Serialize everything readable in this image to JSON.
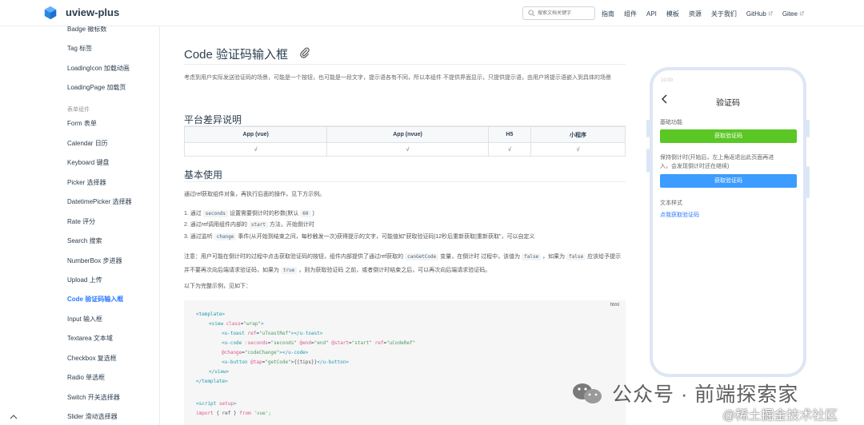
{
  "navbar": {
    "site_name": "uview-plus",
    "search_placeholder": "搜索文档关键字",
    "links": [
      "指南",
      "组件",
      "API",
      "模板",
      "资源",
      "关于我们",
      "GitHub",
      "Gitee"
    ],
    "brand_color": "#2979ff"
  },
  "sidebar": {
    "items": [
      {
        "label": "Badge 徽标数",
        "type": "item"
      },
      {
        "label": "Tag 标签",
        "type": "item"
      },
      {
        "label": "LoadingIcon 加载动画",
        "type": "item"
      },
      {
        "label": "LoadingPage 加载页",
        "type": "item"
      },
      {
        "label": "表单组件",
        "type": "group"
      },
      {
        "label": "Form 表单",
        "type": "item"
      },
      {
        "label": "Calendar 日历",
        "type": "item"
      },
      {
        "label": "Keyboard 键盘",
        "type": "item"
      },
      {
        "label": "Picker 选择器",
        "type": "item"
      },
      {
        "label": "DatetimePicker 选择器",
        "type": "item"
      },
      {
        "label": "Rate 评分",
        "type": "item"
      },
      {
        "label": "Search 搜索",
        "type": "item"
      },
      {
        "label": "NumberBox 步进器",
        "type": "item"
      },
      {
        "label": "Upload 上传",
        "type": "item"
      },
      {
        "label": "Code 验证码输入框",
        "type": "active"
      },
      {
        "label": "Input 输入框",
        "type": "item"
      },
      {
        "label": "Textarea 文本域",
        "type": "item"
      },
      {
        "label": "Checkbox 复选框",
        "type": "item"
      },
      {
        "label": "Radio 单选框",
        "type": "item"
      },
      {
        "label": "Switch 开关选择器",
        "type": "item"
      },
      {
        "label": "Slider 滑动选择器",
        "type": "item"
      }
    ]
  },
  "main": {
    "title": "Code 验证码输入框",
    "intro": "考虑到用户实际发送验证码的场景，可能是一个按钮，也可能是一段文字，提示语各有不同，所以本组件 不提供界面显示，只提供提示语，由用户将提示语嵌入到具体的场景",
    "section1_title": "平台差异说明",
    "table": {
      "headers": [
        "App (vue)",
        "App (nvue)",
        "H5",
        "小程序"
      ],
      "row": [
        "√",
        "√",
        "√",
        "√"
      ]
    },
    "section2_title": "基本使用",
    "usage_intro": "通过ref获取组件对象，再执行后面的操作，见下方示例。",
    "steps": {
      "s1_a": "1. 通过",
      "s1_code": "seconds",
      "s1_b": "设置需要倒计时的秒数(默认",
      "s1_code2": "60",
      "s1_c": ")",
      "s2_a": "2. 通过ref调用组件内部的",
      "s2_code": "start",
      "s2_b": "方法，开始倒计时",
      "s3_a": "3. 通过监听",
      "s3_code": "change",
      "s3_b": "事件(从开始到结束之间，每秒触发一次)获得提示的文字，可能值如\"获取验证码|12秒后重新获取|重新获取\"，可以自定义"
    },
    "note": {
      "a": "注意：用户可能在倒计时的过程中点击获取验证码的按钮，组件内部提供了通过ref获取的",
      "code1": "canGetCode",
      "b": "变量，在倒计时 过程中，该值为",
      "code2": "false",
      "c": "，如果为",
      "code3": "false",
      "d": "应该给予提示并不要再次向后端请求验证码，如果为",
      "code4": "true",
      "e": "，则为获取验证码 之前，或者倒计时结束之后，可以再次向后端请求验证码。"
    },
    "example_intro": "以下为完整示例，见如下：",
    "code": {
      "lang": "html",
      "l1": "<template>",
      "l2_tag": "<view",
      "l2_attr": "class",
      "l2_val": "\"wrap\"",
      "l2_end": ">",
      "l3_tag": "<u-toast",
      "l3_attr": "ref",
      "l3_val": "\"uToastRef\"",
      "l3_end": "></u-toast>",
      "l4_tag": "<u-code",
      "l4_attr1": ":seconds",
      "l4_val1": "\"seconds\"",
      "l4_attr2": "@end",
      "l4_val2": "\"end\"",
      "l4_attr3": "@start",
      "l4_val3": "\"start\"",
      "l4_attr4": "ref",
      "l4_val4": "\"uCodeRef\"",
      "l5_attr": "@change",
      "l5_val": "\"codeChange\"",
      "l5_end": "></u-code>",
      "l6_tag": "<u-button",
      "l6_attr": "@tap",
      "l6_val": "\"getCode\"",
      "l6_text": ">{{tips}}",
      "l6_end": "</u-button>",
      "l7": "</view>",
      "l8": "</template>",
      "l9_tag": "<script",
      "l9_attr": "setup",
      "l9_end": ">",
      "l10_kw": "import",
      "l10_text": "{ ref }",
      "l10_kw2": "from",
      "l10_val": "'vue';"
    }
  },
  "phone": {
    "status_time": "10:00",
    "title": "验证码",
    "section1_label": "基础功能",
    "btn1_label": "获取验证码",
    "btn1_color": "#5ac725",
    "section2_label_l1": "保持倒计时(开始后，左上角返退出此页面再进",
    "section2_label_l2": "入，会发现倒计时还在继续)",
    "btn2_label": "获取验证码",
    "btn2_color": "#3c9cff",
    "section3_label": "文本样式",
    "link_label": "点我获取验证码"
  },
  "watermarks": {
    "wechat": "公众号 · 前端探索家",
    "juejin": "@稀土掘金技术社区"
  }
}
